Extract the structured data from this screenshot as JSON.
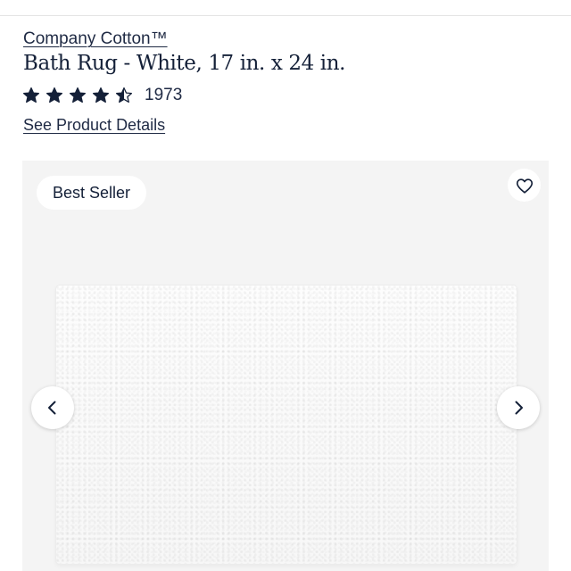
{
  "product": {
    "brand": "Company Cotton™",
    "title": "Bath Rug - White, 17 in. x 24 in.",
    "rating": {
      "stars": 4.5,
      "max_stars": 5,
      "count": "1973"
    },
    "details_link": "See Product Details"
  },
  "gallery": {
    "badge": "Best Seller",
    "image_subject": "white bath rug",
    "wishlist_icon": "heart-outline-icon",
    "prev_icon": "chevron-left-icon",
    "next_icon": "chevron-right-icon"
  },
  "colors": {
    "text": "#142038",
    "gallery_bg": "#f4f4f4",
    "star": "#142038"
  }
}
